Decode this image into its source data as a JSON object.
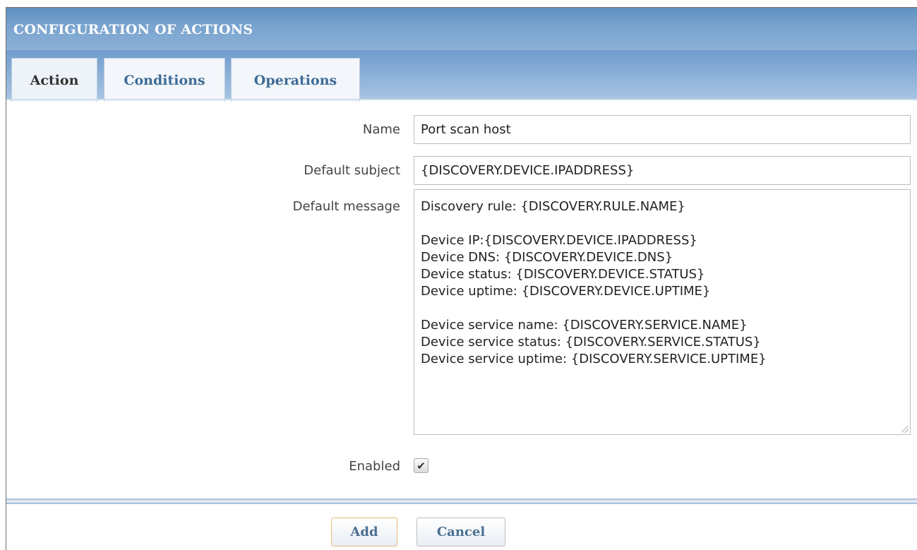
{
  "header": {
    "title": "CONFIGURATION OF ACTIONS"
  },
  "tabs": [
    {
      "label": "Action",
      "active": true
    },
    {
      "label": "Conditions",
      "active": false
    },
    {
      "label": "Operations",
      "active": false
    }
  ],
  "form": {
    "name": {
      "label": "Name",
      "value": "Port scan host"
    },
    "subject": {
      "label": "Default subject",
      "value": "{DISCOVERY.DEVICE.IPADDRESS}"
    },
    "message": {
      "label": "Default message",
      "lines": [
        "Discovery rule: {DISCOVERY.RULE.NAME}",
        "",
        "Device IP:{DISCOVERY.DEVICE.IPADDRESS}",
        "Device DNS: {DISCOVERY.DEVICE.DNS}",
        "Device status: {DISCOVERY.DEVICE.STATUS}",
        "Device uptime: {DISCOVERY.DEVICE.UPTIME}",
        "",
        "Device service name: {DISCOVERY.SERVICE.NAME}",
        "Device service status: {DISCOVERY.SERVICE.STATUS}",
        "Device service uptime: {DISCOVERY.SERVICE.UPTIME}"
      ]
    },
    "enabled": {
      "label": "Enabled",
      "checked": true,
      "check_glyph": "✔"
    }
  },
  "buttons": {
    "add": "Add",
    "cancel": "Cancel"
  },
  "colors": {
    "header": "#6f9ccc",
    "tab_text": "#3e6b96",
    "add_border": "#e3bd73"
  }
}
